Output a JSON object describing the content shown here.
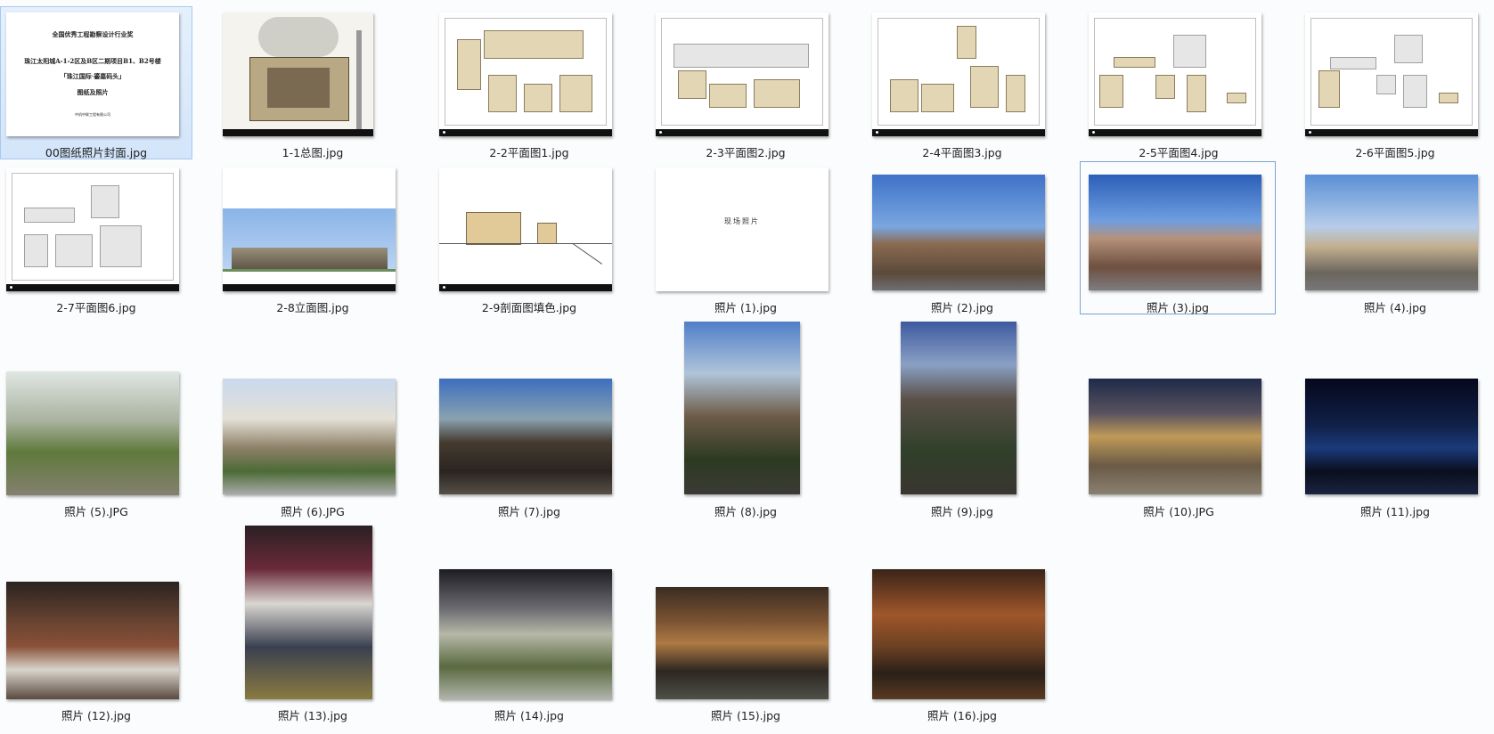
{
  "files": [
    {
      "name": "00图纸照片封面.jpg"
    },
    {
      "name": "1-1总图.jpg"
    },
    {
      "name": "2-2平面图1.jpg"
    },
    {
      "name": "2-3平面图2.jpg"
    },
    {
      "name": "2-4平面图3.jpg"
    },
    {
      "name": "2-5平面图4.jpg"
    },
    {
      "name": "2-6平面图5.jpg"
    },
    {
      "name": "2-7平面图6.jpg"
    },
    {
      "name": "2-8立面图.jpg"
    },
    {
      "name": "2-9剖面图填色.jpg"
    },
    {
      "name": "照片 (1).jpg"
    },
    {
      "name": "照片 (2).jpg"
    },
    {
      "name": "照片 (3).jpg"
    },
    {
      "name": "照片 (4).jpg"
    },
    {
      "name": "照片 (5).JPG"
    },
    {
      "name": "照片 (6).JPG"
    },
    {
      "name": "照片 (7).jpg"
    },
    {
      "name": "照片 (8).jpg"
    },
    {
      "name": "照片 (9).jpg"
    },
    {
      "name": "照片 (10).JPG"
    },
    {
      "name": "照片 (11).jpg"
    },
    {
      "name": "照片 (12).jpg"
    },
    {
      "name": "照片 (13).jpg"
    },
    {
      "name": "照片 (14).jpg"
    },
    {
      "name": "照片 (15).jpg"
    },
    {
      "name": "照片 (16).jpg"
    }
  ],
  "cover": {
    "line1": "全国优秀工程勘察设计行业奖",
    "line2": "珠江太阳城A-1-2区及B区二期项目B1、B2号楼",
    "line3": "「珠江国际·鎏嘉码头」",
    "line4": "图纸及照片",
    "line5": "中机中联工程有限公司"
  },
  "blank_sheet_text": "现场照片",
  "selection": {
    "selected_index": 0,
    "focused_index": 12
  }
}
